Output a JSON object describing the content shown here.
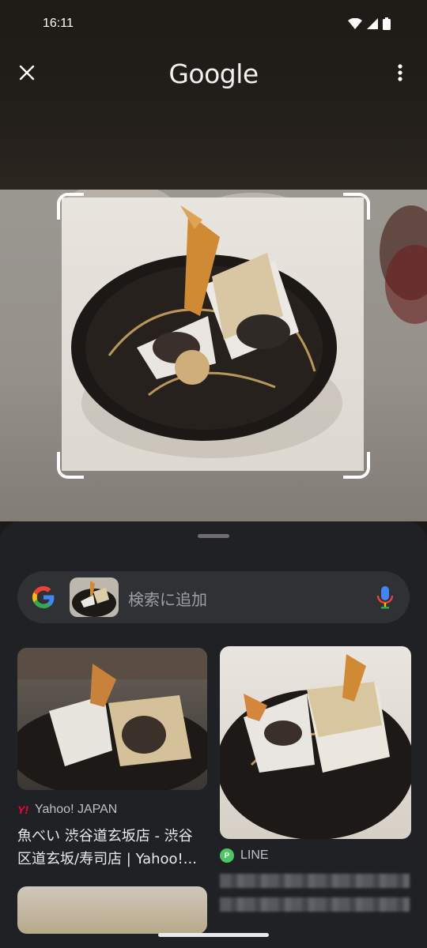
{
  "status_bar": {
    "time": "16:11"
  },
  "app_bar": {
    "title": "Google"
  },
  "search": {
    "placeholder": "検索に追加"
  },
  "results": [
    {
      "source": "Yahoo! JAPAN",
      "title": "魚べい 渋谷道玄坂店 - 渋谷区道玄坂/寿司店 | Yahoo!..."
    },
    {
      "source": "LINE"
    }
  ],
  "colors": {
    "google_blue": "#4285F4",
    "google_red": "#EA4335",
    "google_yellow": "#FBBC05",
    "google_green": "#34A853",
    "line_green": "#4CC764",
    "yahoo_red": "#FF0033"
  }
}
